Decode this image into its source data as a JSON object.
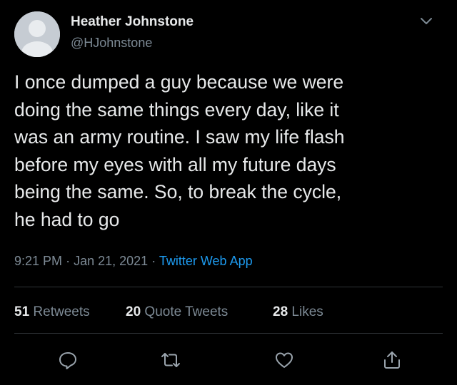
{
  "author": {
    "display_name": "Heather Johnstone",
    "handle": "@HJohnstone",
    "avatar_icon": "default-avatar-icon"
  },
  "tweet": {
    "text": "I once dumped a guy because we were\ndoing the same things every day, like it\nwas an army routine. I saw my life flash\nbefore my eyes with all my future days\nbeing the same. So, to break the cycle,\nhe had to go"
  },
  "meta": {
    "time": "9:21 PM",
    "separator": "·",
    "date": "Jan 21, 2021",
    "source": "Twitter Web App"
  },
  "stats": {
    "retweets_count": "51",
    "retweets_label": "Retweets",
    "quotes_count": "20",
    "quotes_label": "Quote Tweets",
    "likes_count": "28",
    "likes_label": "Likes"
  },
  "actions": [
    "reply-icon",
    "retweet-icon",
    "like-icon",
    "share-icon"
  ],
  "colors": {
    "background": "#000000",
    "text": "#e7e9ea",
    "secondary": "#7d8a95",
    "accent": "#1d9bf0",
    "divider": "#2f3336"
  }
}
